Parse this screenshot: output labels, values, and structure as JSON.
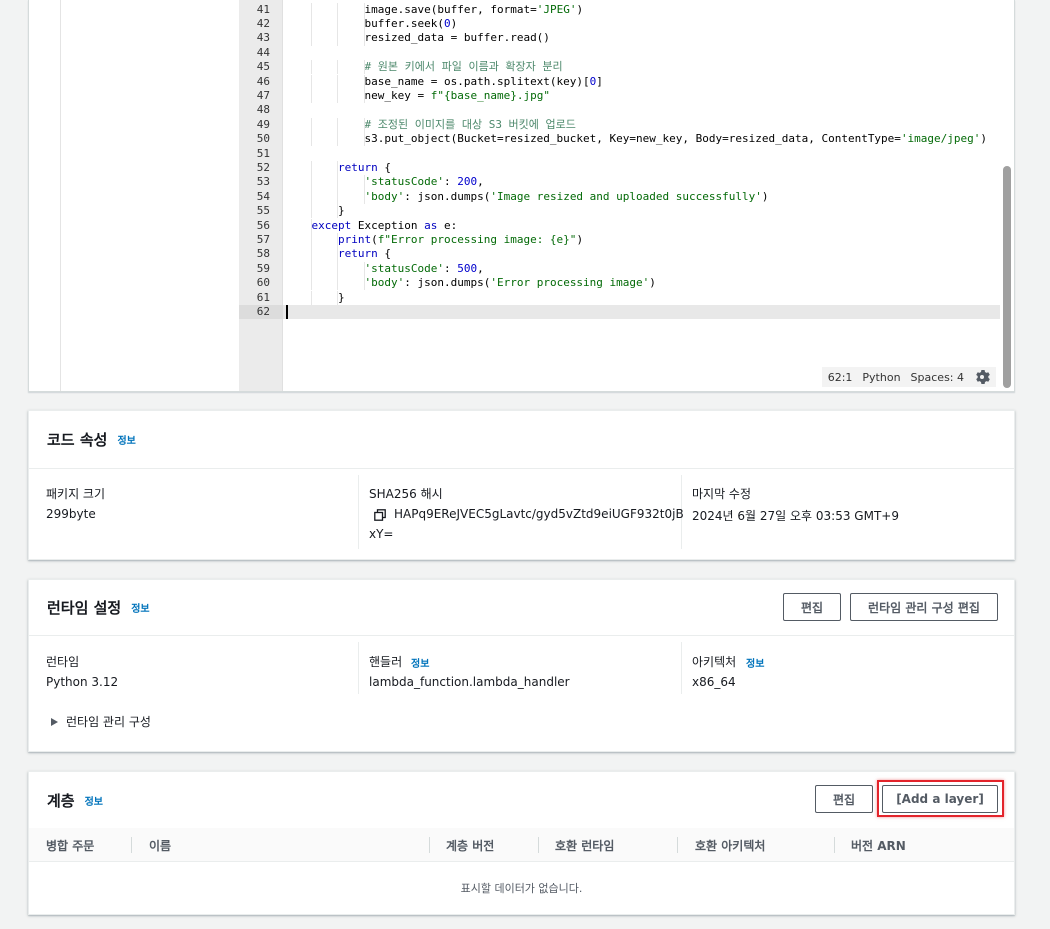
{
  "editor": {
    "lines": [
      {
        "num": "41",
        "indent": 3,
        "tokens": [
          [
            "tok-plain",
            "image.save(buffer, "
          ],
          [
            "tok-plain",
            "format="
          ],
          [
            "tok-str",
            "'JPEG'"
          ],
          [
            "tok-plain",
            ")"
          ]
        ]
      },
      {
        "num": "42",
        "indent": 3,
        "tokens": [
          [
            "tok-plain",
            "buffer.seek("
          ],
          [
            "tok-num",
            "0"
          ],
          [
            "tok-plain",
            ")"
          ]
        ]
      },
      {
        "num": "43",
        "indent": 3,
        "tokens": [
          [
            "tok-plain",
            "resized_data = buffer.read()"
          ]
        ]
      },
      {
        "num": "44",
        "indent": 0,
        "tokens": []
      },
      {
        "num": "45",
        "indent": 3,
        "tokens": [
          [
            "tok-com",
            "# 원본 키에서 파일 이름과 확장자 분리"
          ]
        ]
      },
      {
        "num": "46",
        "indent": 3,
        "tokens": [
          [
            "tok-plain",
            "base_name = os.path.splitext(key)["
          ],
          [
            "tok-num",
            "0"
          ],
          [
            "tok-plain",
            "]"
          ]
        ]
      },
      {
        "num": "47",
        "indent": 3,
        "tokens": [
          [
            "tok-plain",
            "new_key = "
          ],
          [
            "tok-str",
            "f\"{base_name}.jpg\""
          ]
        ]
      },
      {
        "num": "48",
        "indent": 0,
        "tokens": []
      },
      {
        "num": "49",
        "indent": 3,
        "tokens": [
          [
            "tok-com",
            "# 조정된 이미지를 대상 S3 버킷에 업로드"
          ]
        ]
      },
      {
        "num": "50",
        "indent": 3,
        "tokens": [
          [
            "tok-plain",
            "s3.put_object(Bucket=resized_bucket, Key=new_key, Body=resized_data, ContentType="
          ],
          [
            "tok-str",
            "'image/jpeg'"
          ],
          [
            "tok-plain",
            ")"
          ]
        ]
      },
      {
        "num": "51",
        "indent": 0,
        "tokens": []
      },
      {
        "num": "52",
        "indent": 2,
        "tokens": [
          [
            "tok-kw",
            "return"
          ],
          [
            "tok-plain",
            " {"
          ]
        ]
      },
      {
        "num": "53",
        "indent": 3,
        "tokens": [
          [
            "tok-str",
            "'statusCode'"
          ],
          [
            "tok-plain",
            ": "
          ],
          [
            "tok-num",
            "200"
          ],
          [
            "tok-plain",
            ","
          ]
        ]
      },
      {
        "num": "54",
        "indent": 3,
        "tokens": [
          [
            "tok-str",
            "'body'"
          ],
          [
            "tok-plain",
            ": json.dumps("
          ],
          [
            "tok-str",
            "'Image resized and uploaded successfully'"
          ],
          [
            "tok-plain",
            ")"
          ]
        ]
      },
      {
        "num": "55",
        "indent": 2,
        "tokens": [
          [
            "tok-plain",
            "}"
          ]
        ]
      },
      {
        "num": "56",
        "indent": 1,
        "tokens": [
          [
            "tok-kw",
            "except"
          ],
          [
            "tok-plain",
            " Exception "
          ],
          [
            "tok-kw",
            "as"
          ],
          [
            "tok-plain",
            " e:"
          ]
        ]
      },
      {
        "num": "57",
        "indent": 2,
        "tokens": [
          [
            "tok-kw",
            "print"
          ],
          [
            "tok-plain",
            "("
          ],
          [
            "tok-str",
            "f\"Error processing image: {e}\""
          ],
          [
            "tok-plain",
            ")"
          ]
        ]
      },
      {
        "num": "58",
        "indent": 2,
        "tokens": [
          [
            "tok-kw",
            "return"
          ],
          [
            "tok-plain",
            " {"
          ]
        ]
      },
      {
        "num": "59",
        "indent": 3,
        "tokens": [
          [
            "tok-str",
            "'statusCode'"
          ],
          [
            "tok-plain",
            ": "
          ],
          [
            "tok-num",
            "500"
          ],
          [
            "tok-plain",
            ","
          ]
        ]
      },
      {
        "num": "60",
        "indent": 3,
        "tokens": [
          [
            "tok-str",
            "'body'"
          ],
          [
            "tok-plain",
            ": json.dumps("
          ],
          [
            "tok-str",
            "'Error processing image'"
          ],
          [
            "tok-plain",
            ")"
          ]
        ]
      },
      {
        "num": "61",
        "indent": 2,
        "tokens": [
          [
            "tok-plain",
            "}"
          ]
        ]
      },
      {
        "num": "62",
        "indent": 0,
        "tokens": []
      }
    ],
    "status": {
      "position": "62:1",
      "language": "Python",
      "spaces": "Spaces: 4"
    }
  },
  "code_properties": {
    "title": "코드 속성",
    "info": "정보",
    "package_size_label": "패키지 크기",
    "package_size_value": "299byte",
    "sha_label": "SHA256 해시",
    "sha_value_line1": "HAPq9EReJVEC5gLavtc/gyd5vZtd9eiUGF932t0jB",
    "sha_value_line2": "xY=",
    "modified_label": "마지막 수정",
    "modified_value": "2024년 6월 27일 오후 03:53 GMT+9"
  },
  "runtime_settings": {
    "title": "런타임 설정",
    "info": "정보",
    "edit_label": "편집",
    "edit_mgmt_label": "런타임 관리 구성 편집",
    "runtime_label": "런타임",
    "runtime_value": "Python 3.12",
    "handler_label": "핸들러",
    "handler_info": "정보",
    "handler_value": "lambda_function.lambda_handler",
    "arch_label": "아키텍처",
    "arch_info": "정보",
    "arch_value": "x86_64",
    "mgmt_expander": "런타임 관리 구성"
  },
  "layers": {
    "title": "계층",
    "info": "정보",
    "edit_label": "편집",
    "add_layer_label": "[Add a layer]",
    "columns": [
      "병합 주문",
      "이름",
      "계층 버전",
      "호환 런타임",
      "호환 아키텍처",
      "버전 ARN"
    ],
    "empty_message": "표시할 데이터가 없습니다."
  }
}
